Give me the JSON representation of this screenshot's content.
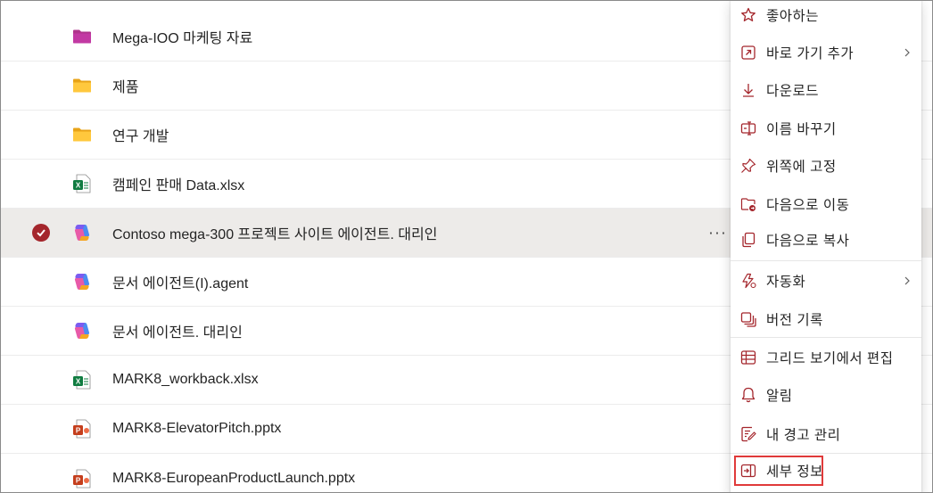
{
  "files": [
    {
      "name": "Mega-IOO 마케팅 자료",
      "type": "folder-pink"
    },
    {
      "name": "제품",
      "type": "folder"
    },
    {
      "name": "연구 개발",
      "type": "folder"
    },
    {
      "name": "캠페인 판매 Data.xlsx",
      "type": "excel"
    },
    {
      "name": "Contoso mega-300 프로젝트 사이트 에이전트. 대리인",
      "type": "copilot",
      "selected": true,
      "more": "···"
    },
    {
      "name": "문서 에이전트(I).agent",
      "type": "copilot"
    },
    {
      "name": "문서 에이전트. 대리인",
      "type": "copilot"
    },
    {
      "name": "MARK8_workback.xlsx",
      "type": "excel"
    },
    {
      "name": "MARK8-ElevatorPitch.pptx",
      "type": "powerpoint"
    },
    {
      "name": "MARK8-EuropeanProductLaunch.pptx",
      "type": "powerpoint"
    }
  ],
  "context_menu": {
    "items": [
      {
        "label": "좋아하는",
        "icon": "star-icon"
      },
      {
        "label": "바로 가기 추가",
        "icon": "shortcut-icon",
        "submenu": true
      },
      {
        "label": "다운로드",
        "icon": "download-icon"
      },
      {
        "label": "이름 바꾸기",
        "icon": "rename-icon"
      },
      {
        "label": "위쪽에 고정",
        "icon": "pin-icon"
      },
      {
        "label": "다음으로 이동",
        "icon": "move-icon"
      },
      {
        "label": "다음으로 복사",
        "icon": "copy-icon"
      },
      {
        "label": "자동화",
        "icon": "automate-icon",
        "submenu": true
      },
      {
        "label": "버전 기록",
        "icon": "version-history-icon"
      },
      {
        "label": "그리드 보기에서 편집",
        "icon": "grid-icon"
      },
      {
        "label": "알림",
        "icon": "bell-icon"
      },
      {
        "label": "내 경고 관리",
        "icon": "manage-alerts-icon"
      },
      {
        "label": "세부 정보",
        "icon": "details-icon",
        "highlighted": true
      }
    ]
  },
  "colors": {
    "accent": "#a4262c",
    "highlight_border": "#e03a3a",
    "selected_row": "#edebe9"
  }
}
